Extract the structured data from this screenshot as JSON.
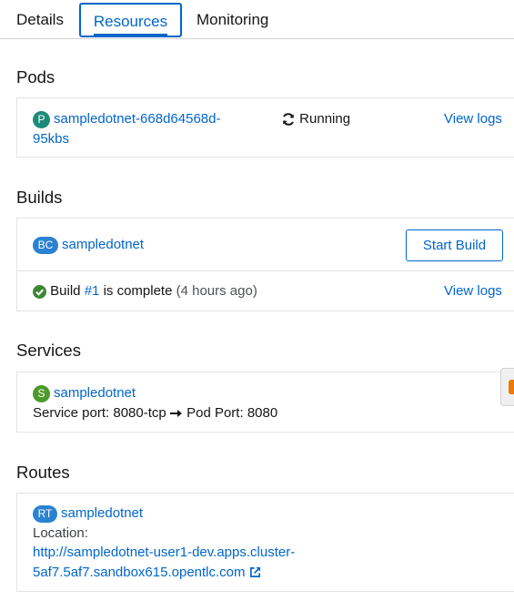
{
  "tabs": {
    "details": "Details",
    "resources": "Resources",
    "monitoring": "Monitoring"
  },
  "pods": {
    "heading": "Pods",
    "badge": "P",
    "name_line1": "sampledotnet-668d64568d-",
    "name_line2": "95kbs",
    "status": "Running",
    "view_logs": "View logs"
  },
  "builds": {
    "heading": "Builds",
    "badge": "BC",
    "name": "sampledotnet",
    "start_build": "Start Build",
    "build_prefix": "Build",
    "build_link": "#1",
    "build_status": "is complete",
    "build_time": "(4 hours ago)",
    "view_logs": "View logs"
  },
  "services": {
    "heading": "Services",
    "badge": "S",
    "name": "sampledotnet",
    "service_port_label": "Service port:",
    "service_port": "8080-tcp",
    "pod_port_label": "Pod Port:",
    "pod_port": "8080"
  },
  "routes": {
    "heading": "Routes",
    "badge": "RT",
    "name": "sampledotnet",
    "location_label": "Location:",
    "url_line1": "http://sampledotnet-user1-dev.apps.cluster-",
    "url_line2": "5af7.5af7.sandbox615.opentlc.com"
  },
  "colors": {
    "link": "#0066cc",
    "success": "#3e8635",
    "pod_badge": "#1d8a79",
    "bc_badge": "#2b82d1",
    "service_badge": "#4c9a2a"
  }
}
